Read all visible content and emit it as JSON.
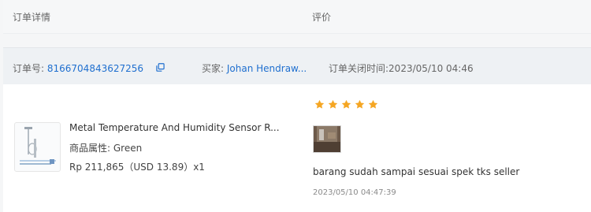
{
  "header": {
    "order_details_label": "订单详情",
    "review_label": "评价"
  },
  "order": {
    "id_label": "订单号:",
    "id": "8166704843627256",
    "buyer_label": "买家:",
    "buyer": "Johan Hendraw...",
    "closed_time": "订单关闭时间:2023/05/10 04:46"
  },
  "product": {
    "title": "Metal Temperature And Humidity Sensor R...",
    "attr_label": "商品属性:",
    "attr_value": "Green",
    "price": "Rp 211,865（USD  13.89）x1"
  },
  "review": {
    "rating": 5,
    "text": "barang sudah sampai sesuai spek tks seller",
    "time": "2023/05/10 04:47:39",
    "star_color": "#f5a623"
  },
  "colors": {
    "link": "#1f6fcf"
  },
  "icons": {
    "copy": "copy-icon",
    "star": "star-icon"
  }
}
